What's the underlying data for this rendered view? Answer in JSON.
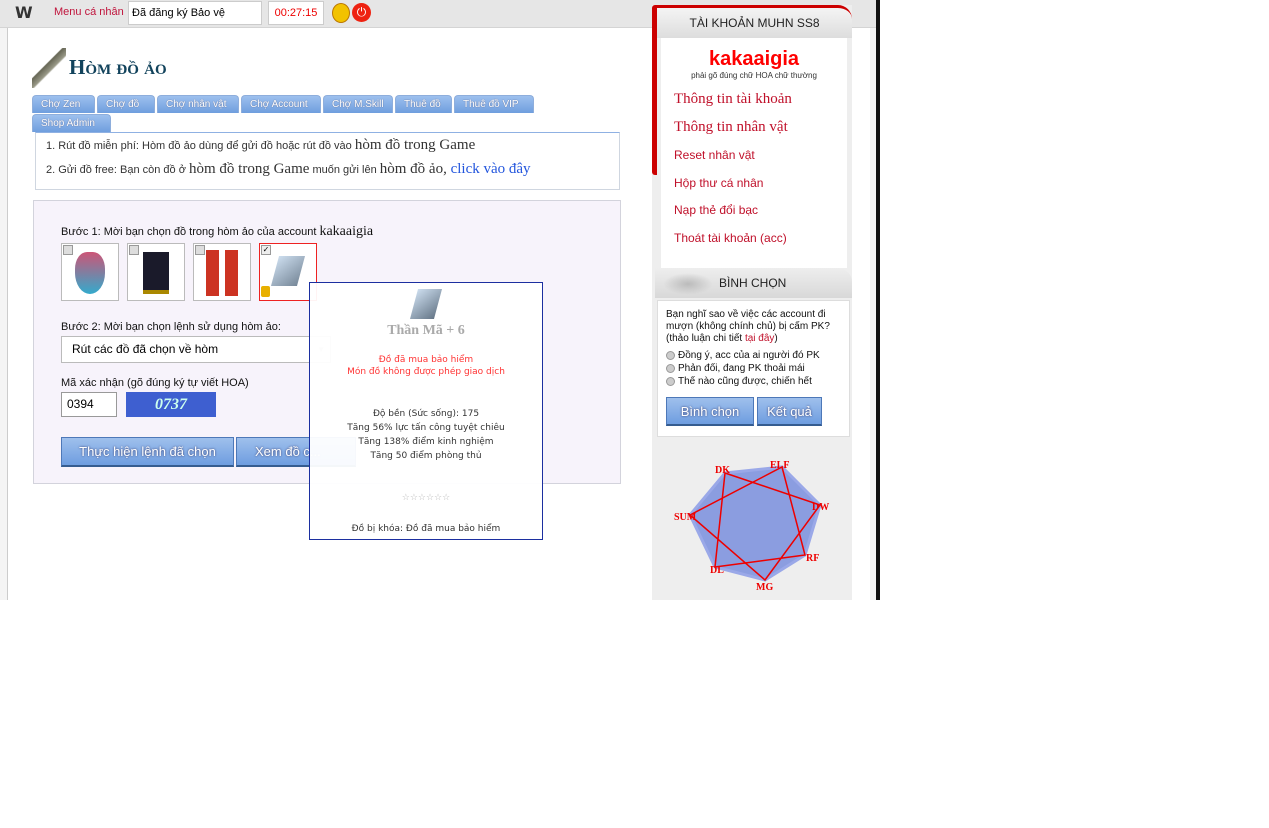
{
  "topbar": {
    "logo": "W",
    "menu": "Menu cá nhân",
    "protect": "Đã đăng ký Bảo vệ ACC",
    "timer": "00:27:15"
  },
  "page": {
    "title": "Hòm đồ ảo",
    "tabs": [
      "Chợ Zen",
      "Chợ đồ",
      "Chợ nhân vật",
      "Chợ Account",
      "Chợ M.Skill",
      "Thuê đồ",
      "Thuê đồ VIP",
      "Shop Admin"
    ],
    "info": {
      "line1_prefix": "1. Rút đồ miễn phí: Hòm đồ ảo dùng để gửi đồ hoặc rút đồ vào ",
      "line1_big": "hòm đồ trong Game",
      "line2_prefix": "2. Gửi đồ free: Bạn còn đồ ở ",
      "line2_big1": "hòm đồ trong Game",
      "line2_mid": " muốn gửi lên ",
      "line2_big2": "hòm đồ ảo,",
      "line2_link": " click vào đây"
    },
    "step1": "Bước 1: Mời bạn chọn đồ trong hòm ảo của account ",
    "account": "kakaaigia",
    "items": [
      {
        "checked": false
      },
      {
        "checked": false
      },
      {
        "checked": false
      },
      {
        "checked": true,
        "locked": true
      }
    ],
    "step2": "Bước 2: Mời bạn chọn lệnh sử dụng hòm ảo:",
    "select_value": "Rút các đồ đã chọn về hòm",
    "captcha_label": "Mã xác nhận (gõ đúng ký tự viết HOA)",
    "captcha_value": "0394",
    "captcha_image_text": "0737",
    "btn_execute": "Thực hiện lệnh đã chọn",
    "btn_view": "Xem đồ c..."
  },
  "tooltip": {
    "name": "Thần Mã + 6",
    "warn1": "Đồ đã mua bảo hiểm",
    "warn2": "Món đồ không được phép giao dịch",
    "stats": [
      "Độ bền (Sức sống): 175",
      "Tăng 56% lực tấn công tuyệt chiêu",
      "Tăng 138% điểm kinh nghiệm",
      "Tăng 50 điểm phòng thủ"
    ],
    "stars": "☆☆☆☆☆☆",
    "lock": "Đồ bị khóa: Đồ đã mua bảo hiểm"
  },
  "sidebar": {
    "header": "TÀI KHOẢN MUHN SS8",
    "username": "kakaaigia",
    "hint": "phải gõ đúng chữ HOA chữ thường",
    "links": [
      "Thông tin tài khoản",
      "Thông tin nhân vật",
      "Reset nhân vật",
      "Hộp thư cá nhân",
      "Nạp thẻ đổi bạc",
      "Thoát tài khoản (acc)"
    ],
    "poll_header": "BÌNH CHỌN",
    "poll_question": "Bạn nghĩ sao về việc các account đi mượn (không chính chủ) bị cấm PK? (thảo luận chi tiết ",
    "poll_link": "tại đây",
    "poll_close": ")",
    "options": [
      "Đồng ý, acc của ai người đó PK",
      "Phản đối, đang PK thoải mái",
      "Thế nào cũng được, chiến hết"
    ],
    "vote": "Bình chọn",
    "result": "Kết quả",
    "classes": [
      "DK",
      "ELF",
      "DW",
      "RF",
      "MG",
      "DL",
      "SUM"
    ]
  },
  "colors": {
    "accent": "#c0102a",
    "tab": "#7fa8e0",
    "tooltip_border": "#1c2fa0"
  }
}
